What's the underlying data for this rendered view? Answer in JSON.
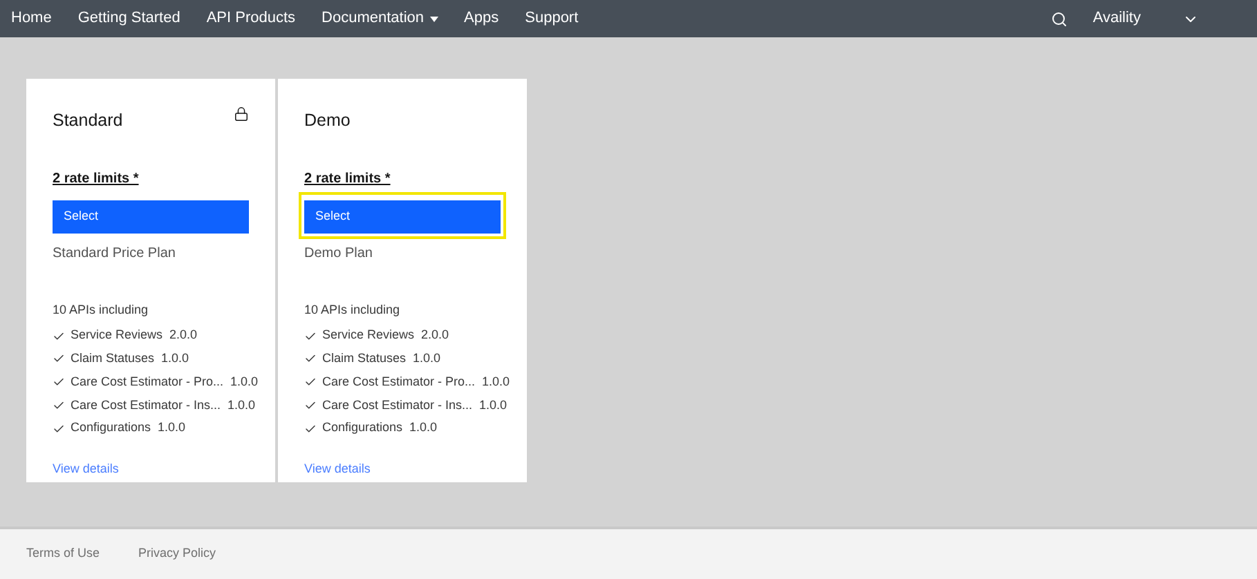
{
  "nav": {
    "items": [
      {
        "label": "Home",
        "has_menu": false
      },
      {
        "label": "Getting Started",
        "has_menu": false
      },
      {
        "label": "API Products",
        "has_menu": false
      },
      {
        "label": "Documentation",
        "has_menu": true
      },
      {
        "label": "Apps",
        "has_menu": false
      },
      {
        "label": "Support",
        "has_menu": false
      }
    ],
    "account": "Availity"
  },
  "plans": [
    {
      "title": "Standard",
      "locked": true,
      "rate_limits": "2 rate limits *",
      "button": "Select",
      "focused": false,
      "description": "Standard Price Plan",
      "apis_heading": "10 APIs including",
      "apis": [
        {
          "name": "Service Reviews",
          "version": "2.0.0"
        },
        {
          "name": "Claim Statuses",
          "version": "1.0.0"
        },
        {
          "name": "Care Cost Estimator - Pro...",
          "version": "1.0.0"
        },
        {
          "name": "Care Cost Estimator - Ins...",
          "version": "1.0.0"
        },
        {
          "name": "Configurations",
          "version": "1.0.0"
        }
      ],
      "link": "View details"
    },
    {
      "title": "Demo",
      "locked": false,
      "rate_limits": "2 rate limits *",
      "button": "Select",
      "focused": true,
      "description": "Demo Plan",
      "apis_heading": "10 APIs including",
      "apis": [
        {
          "name": "Service Reviews",
          "version": "2.0.0"
        },
        {
          "name": "Claim Statuses",
          "version": "1.0.0"
        },
        {
          "name": "Care Cost Estimator - Pro...",
          "version": "1.0.0"
        },
        {
          "name": "Care Cost Estimator - Ins...",
          "version": "1.0.0"
        },
        {
          "name": "Configurations",
          "version": "1.0.0"
        }
      ],
      "link": "View details"
    }
  ],
  "footer": {
    "links": [
      "Terms of Use",
      "Privacy Policy"
    ]
  }
}
